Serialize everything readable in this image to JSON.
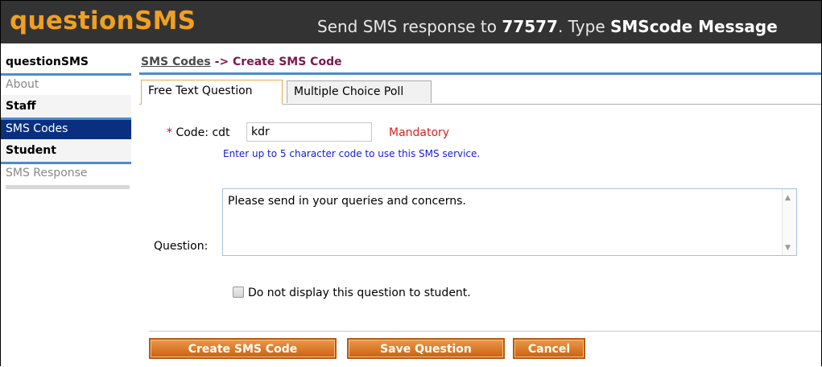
{
  "header": {
    "logo": "questionSMS",
    "tagline_prefix": "Send SMS response to ",
    "tagline_number": "77577",
    "tagline_middle": ". Type ",
    "tagline_code": "SMScode Message"
  },
  "sidebar": {
    "sections": [
      {
        "title": "questionSMS",
        "items": [
          "About"
        ]
      },
      {
        "title": "Staff",
        "items": [
          "SMS Codes"
        ]
      },
      {
        "title": "Student",
        "items": [
          "SMS Response"
        ]
      }
    ],
    "active_item": "SMS Codes"
  },
  "breadcrumb": {
    "link": "SMS Codes",
    "separator": " -> ",
    "current": "Create SMS Code"
  },
  "tabs": [
    "Free Text Question",
    "Multiple Choice Poll"
  ],
  "form": {
    "required_marker": "*",
    "code_label": "Code:",
    "code_prefix": "cdt",
    "code_value": "kdr",
    "mandatory_text": "Mandatory",
    "code_hint": "Enter up to 5 character code to use this SMS service.",
    "question_label": "Question:",
    "question_value": "Please send in your queries and concerns.",
    "hide_checkbox_label": "Do not display this question to student.",
    "hide_checkbox_checked": false
  },
  "buttons": {
    "create": "Create SMS Code",
    "save": "Save Question",
    "cancel": "Cancel"
  },
  "colors": {
    "header_bg": "#333333",
    "logo": "#f0a020",
    "accent_blue": "#4a8ccd",
    "active_nav": "#0a2f80",
    "button_orange": "#d96f1c"
  }
}
